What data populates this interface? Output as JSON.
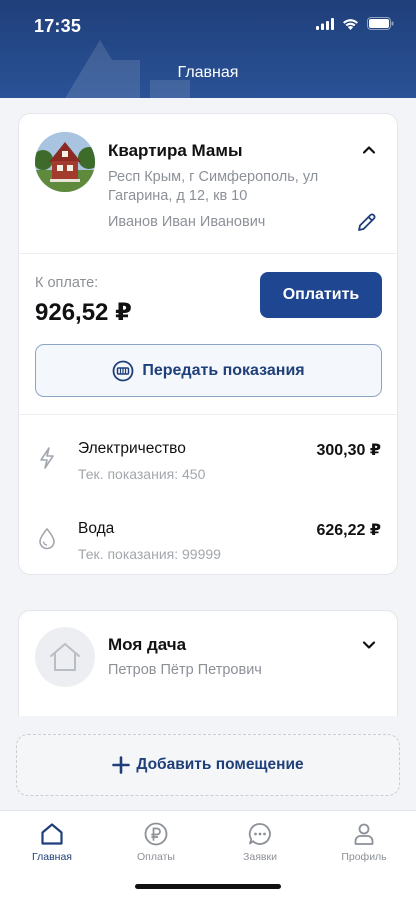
{
  "status_bar": {
    "time": "17:35"
  },
  "header": {
    "title": "Главная"
  },
  "properties": [
    {
      "title": "Квартира Мамы",
      "address": "Респ Крым, г Симферополь, ул Гагарина, д 12, кв 10",
      "owner": "Иванов Иван Иванович",
      "expanded": true,
      "payment": {
        "label": "К оплате:",
        "amount": "926,52 ₽",
        "button": "Оплатить"
      },
      "readings_button": "Передать показания",
      "services": [
        {
          "name": "Электричество",
          "reading": "Тек. показания: 450",
          "amount": "300,30 ₽",
          "icon": "lightning-icon"
        },
        {
          "name": "Вода",
          "reading": "Тек. показания: 99999",
          "amount": "626,22 ₽",
          "icon": "water-drop-icon"
        }
      ]
    },
    {
      "title": "Моя дача",
      "owner": "Петров Пётр Петрович",
      "expanded": false
    }
  ],
  "add_button": "Добавить помещение",
  "tabs": [
    {
      "label": "Главная",
      "icon": "home-icon",
      "active": true
    },
    {
      "label": "Оплаты",
      "icon": "ruble-coin-icon",
      "active": false
    },
    {
      "label": "Заявки",
      "icon": "chat-bubble-icon",
      "active": false
    },
    {
      "label": "Профиль",
      "icon": "person-icon",
      "active": false
    }
  ],
  "colors": {
    "primary": "#1f4690",
    "header": "#2a5296",
    "muted": "#8c9198",
    "background": "#f2f4f7"
  }
}
